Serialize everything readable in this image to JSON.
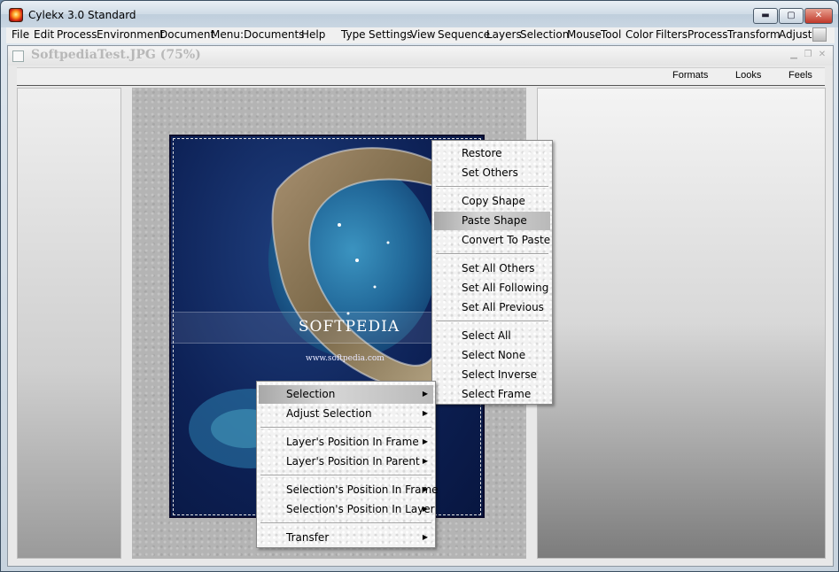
{
  "window": {
    "title": "Cylekx 3.0 Standard",
    "min_label": "▬",
    "max_label": "▢",
    "close_label": "✕"
  },
  "menubar": {
    "items": [
      "File",
      "Edit",
      "Process",
      "Environment",
      "Document",
      "Menu:",
      "Documents",
      "Help",
      "Type",
      "Settings",
      "View",
      "Sequence",
      "Layers",
      "Selection",
      "Mouse",
      "Tool",
      "Color",
      "Filters",
      "Process",
      "Transform",
      "Adjust"
    ]
  },
  "document": {
    "title": "SoftpediaTest.JPG (75%)",
    "toolbar": [
      "Formats",
      "Looks",
      "Feels"
    ],
    "watermark": "SOFTPEDIA",
    "url": "www.softpedia.com"
  },
  "context_menu_right": {
    "items": [
      "Restore",
      "Set Others",
      "Copy Shape",
      "Paste Shape",
      "Convert To Paste",
      "Set All Others",
      "Set All Following",
      "Set All Previous",
      "Select All",
      "Select None",
      "Select Inverse",
      "Select Frame"
    ],
    "highlighted": "Paste Shape"
  },
  "context_menu_left": {
    "items": [
      "Selection",
      "Adjust Selection",
      "Layer's Position In Frame",
      "Layer's Position In Parent",
      "Selection's Position In Frame",
      "Selection's Position In Layer",
      "Transfer"
    ],
    "highlighted": "Selection"
  },
  "icons": {
    "app": "cylekx-app-icon",
    "submenu": "triangle-right-icon"
  }
}
